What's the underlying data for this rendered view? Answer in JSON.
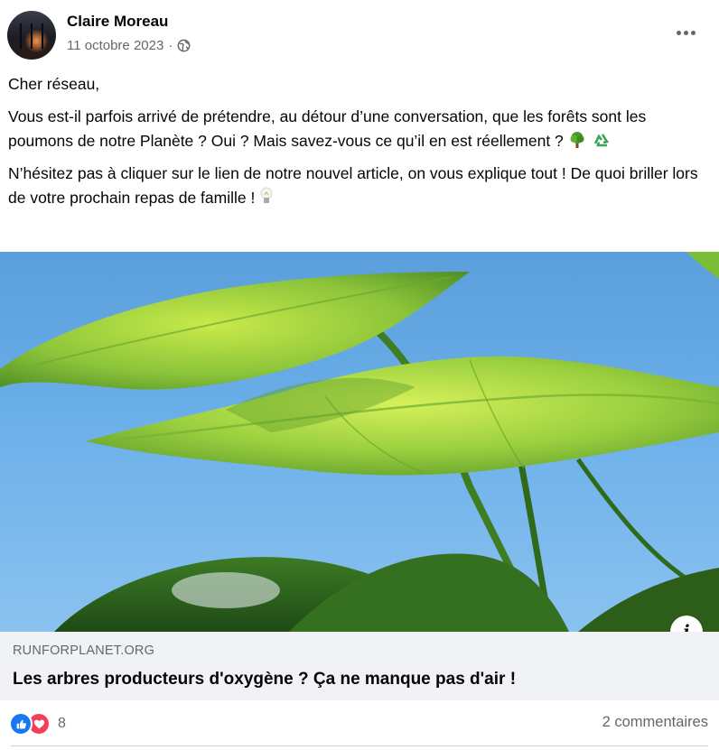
{
  "post": {
    "author": "Claire Moreau",
    "date": "11 octobre 2023",
    "separator": "·",
    "privacy_icon": "globe-icon",
    "menu_icon": "more-options-icon"
  },
  "body": {
    "greeting": "Cher réseau,",
    "paragraph1": "Vous est-il parfois  arrivé de prétendre, au détour d’une conversation, que les forêts sont  les poumons de notre Planète ? Oui ? Mais savez-vous ce qu’il en est réellement ?",
    "paragraph1_emojis": [
      "tree-emoji",
      "recycle-emoji"
    ],
    "paragraph2": "N’hésitez pas à cliquer sur le lien de notre  nouvel article, on vous explique tout ! De quoi briller lors de votre  prochain repas de famille !",
    "paragraph2_emojis": [
      "lightbulb-emoji"
    ]
  },
  "link": {
    "domain": "RUNFORPLANET.ORG",
    "title": "Les arbres producteurs d'oxygène ? Ça ne manque pas d'air !",
    "info_icon": "info-icon"
  },
  "footer": {
    "reaction_icons": [
      "like-icon",
      "love-icon"
    ],
    "reaction_count": "8",
    "comments": "2 commentaires"
  },
  "colors": {
    "secondary_text": "#65676b",
    "link_card_bg": "#f0f2f5",
    "like_blue": "#1877f2",
    "love_red": "#f33e58"
  }
}
